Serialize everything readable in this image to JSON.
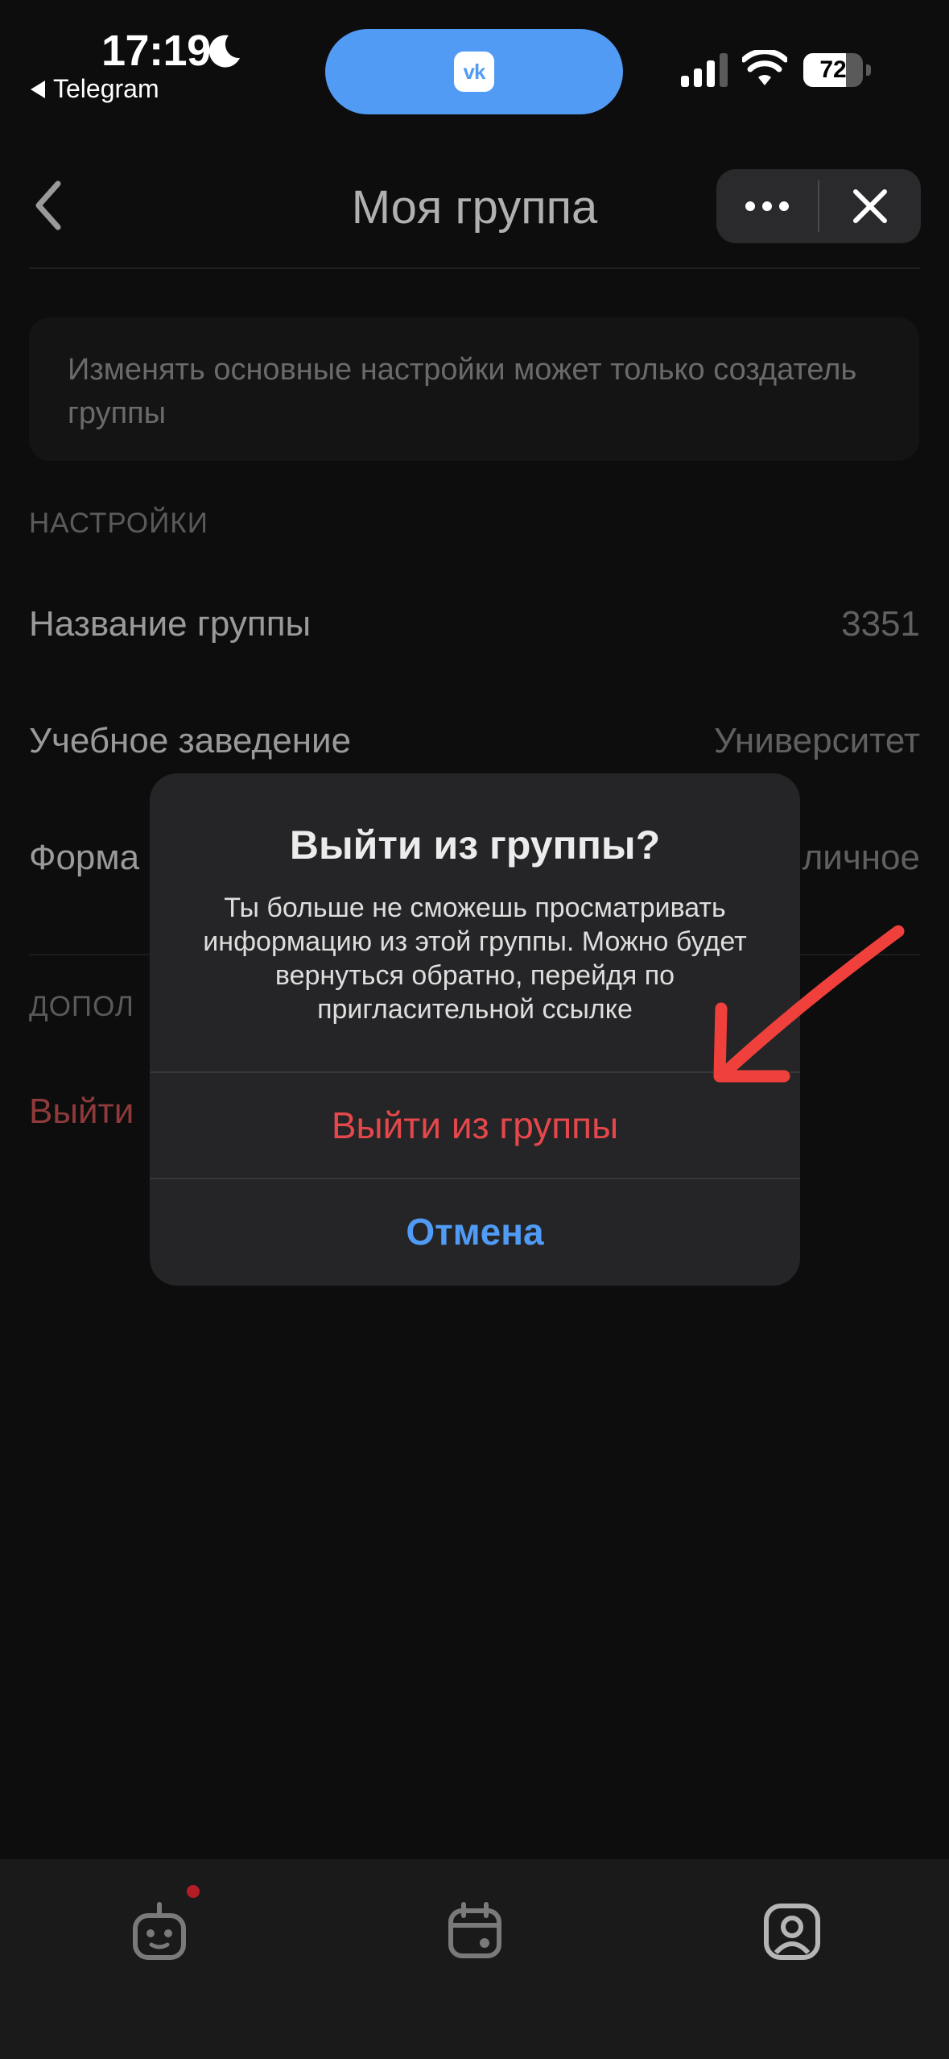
{
  "status_bar": {
    "time": "17:19",
    "back_app": "Telegram",
    "battery": "72",
    "battery_level": 0.72,
    "island_app": "VK"
  },
  "header": {
    "title": "Моя группа",
    "back_icon": "chevron-left-icon",
    "more_icon": "more-horizontal-icon",
    "close_icon": "close-icon"
  },
  "info_card": {
    "text": "Изменять основные настройки может только создатель группы"
  },
  "settings": {
    "section_label": "НАСТРОЙКИ",
    "rows": [
      {
        "label": "Название группы",
        "value": "3351"
      },
      {
        "label": "Учебное заведение",
        "value": "Университет"
      },
      {
        "label": "Форма",
        "value": "личное"
      }
    ],
    "extra_section_label": "ДОПОЛ",
    "leave_label": "Выйти"
  },
  "alert": {
    "title": "Выйти из группы?",
    "message": "Ты больше не сможешь просматривать информацию из этой группы. Можно будет вернуться обратно, перейдя по пригласительной ссылке",
    "leave_button": "Выйти из группы",
    "cancel_button": "Отмена"
  },
  "tabbar": {
    "tabs": [
      {
        "icon": "bot-icon",
        "has_badge": true
      },
      {
        "icon": "calendar-icon"
      },
      {
        "icon": "profile-icon"
      }
    ]
  },
  "colors": {
    "accent_blue": "#4f9bf5",
    "danger_red": "#e5474b",
    "annotation_arrow": "#f0403c"
  }
}
